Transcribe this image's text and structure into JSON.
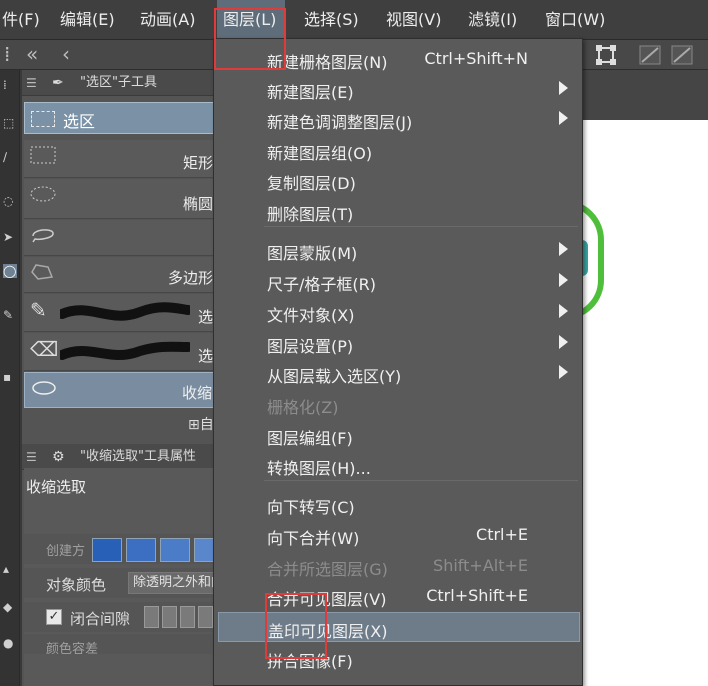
{
  "menubar": {
    "items": [
      {
        "label": "件(F)"
      },
      {
        "label": "编辑(E)"
      },
      {
        "label": "动画(A)"
      },
      {
        "label": "图层(L)"
      },
      {
        "label": "选择(S)"
      },
      {
        "label": "视图(V)"
      },
      {
        "label": "滤镜(I)"
      },
      {
        "label": "窗口(W)"
      }
    ],
    "active_index": 3
  },
  "subtool_panel": {
    "header_title": "\"选区\"子工具",
    "group_label": "选区",
    "tools": [
      {
        "label": "矩形"
      },
      {
        "label": "椭圆"
      },
      {
        "label": ""
      },
      {
        "label": "多边形"
      },
      {
        "label": "选"
      },
      {
        "label": "选"
      },
      {
        "label": "收缩"
      }
    ],
    "small_label": "自"
  },
  "props_panel": {
    "header_title": "\"收缩选取\"工具属性",
    "tool_name": "收缩选取",
    "create_label": "创建方",
    "object_color_label": "对象颜色",
    "object_color_value": "除透明之外和内",
    "close_gap_label": "闭合间隙",
    "close_gap_check": "✓",
    "color_tolerance_label": "颜色容差"
  },
  "layer_menu": {
    "items": [
      {
        "label": "新建栅格图层(N)",
        "shortcut": "Ctrl+Shift+N",
        "submenu": false,
        "disabled": false
      },
      {
        "label": "新建图层(E)",
        "shortcut": "",
        "submenu": true,
        "disabled": false
      },
      {
        "label": "新建色调调整图层(J)",
        "shortcut": "",
        "submenu": true,
        "disabled": false
      },
      {
        "label": "新建图层组(O)",
        "shortcut": "",
        "submenu": false,
        "disabled": false
      },
      {
        "label": "复制图层(D)",
        "shortcut": "",
        "submenu": false,
        "disabled": false
      },
      {
        "label": "删除图层(T)",
        "shortcut": "",
        "submenu": false,
        "disabled": false
      },
      {
        "label": "图层蒙版(M)",
        "shortcut": "",
        "submenu": true,
        "disabled": false
      },
      {
        "label": "尺子/格子框(R)",
        "shortcut": "",
        "submenu": true,
        "disabled": false
      },
      {
        "label": "文件对象(X)",
        "shortcut": "",
        "submenu": true,
        "disabled": false
      },
      {
        "label": "图层设置(P)",
        "shortcut": "",
        "submenu": true,
        "disabled": false
      },
      {
        "label": "从图层载入选区(Y)",
        "shortcut": "",
        "submenu": true,
        "disabled": false
      },
      {
        "label": "栅格化(Z)",
        "shortcut": "",
        "submenu": false,
        "disabled": true
      },
      {
        "label": "图层编组(F)",
        "shortcut": "",
        "submenu": false,
        "disabled": false
      },
      {
        "label": "转换图层(H)...",
        "shortcut": "",
        "submenu": false,
        "disabled": false
      },
      {
        "label": "向下转写(C)",
        "shortcut": "",
        "submenu": false,
        "disabled": false
      },
      {
        "label": "向下合并(W)",
        "shortcut": "Ctrl+E",
        "submenu": false,
        "disabled": false
      },
      {
        "label": "合并所选图层(G)",
        "shortcut": "Shift+Alt+E",
        "submenu": false,
        "disabled": true
      },
      {
        "label": "合并可见图层(V)",
        "shortcut": "Ctrl+Shift+E",
        "submenu": false,
        "disabled": false
      },
      {
        "label": "盖印可见图层(X)",
        "shortcut": "",
        "submenu": false,
        "disabled": false
      },
      {
        "label": "拼合图像(F)",
        "shortcut": "",
        "submenu": false,
        "disabled": false
      }
    ],
    "highlighted_index": 18
  },
  "colors": {
    "menu_bg": "#5a5a5a",
    "highlight": "#6e7c89",
    "annotation_red": "#e03a3a",
    "ring_green": "#4fbf3b"
  }
}
